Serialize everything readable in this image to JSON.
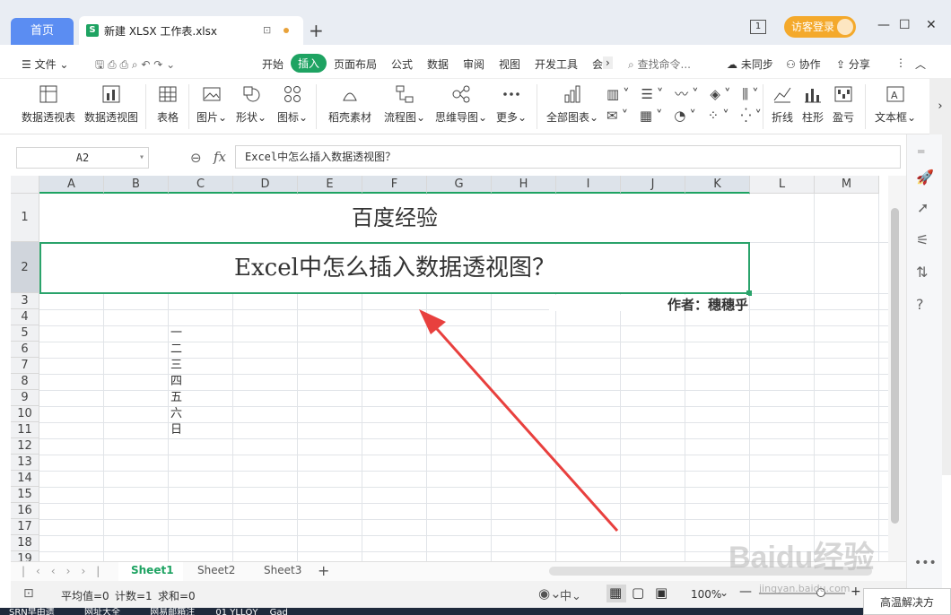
{
  "tabs": {
    "home": "首页",
    "file_badge": "S",
    "file_name": "新建 XLSX 工作表.xlsx",
    "new_tab": "+"
  },
  "window": {
    "page_num": "1",
    "login": "访客登录",
    "minimize": "—",
    "maximize": "☐",
    "close": "✕"
  },
  "menu": {
    "file": "文件",
    "items": [
      "开始",
      "插入",
      "页面布局",
      "公式",
      "数据",
      "审阅",
      "视图",
      "开发工具",
      "会"
    ],
    "active": "插入",
    "search": "查找命令...",
    "sync": "未同步",
    "collab": "协作",
    "share": "分享"
  },
  "ribbon": [
    {
      "label": "数据透视表",
      "icon": "pivot-table-icon"
    },
    {
      "label": "数据透视图",
      "icon": "pivot-chart-icon"
    },
    {
      "label": "表格",
      "icon": "table-icon"
    },
    {
      "label": "图片",
      "icon": "picture-icon"
    },
    {
      "label": "形状",
      "icon": "shape-icon"
    },
    {
      "label": "图标",
      "icon": "icons-icon"
    },
    {
      "label": "稻壳素材",
      "icon": "material-icon"
    },
    {
      "label": "流程图",
      "icon": "flowchart-icon"
    },
    {
      "label": "思维导图",
      "icon": "mindmap-icon"
    },
    {
      "label": "更多",
      "icon": "more-icon"
    },
    {
      "label": "全部图表",
      "icon": "all-charts-icon"
    },
    {
      "label": "折线",
      "icon": "line-chart-icon"
    },
    {
      "label": "柱形",
      "icon": "column-chart-icon"
    },
    {
      "label": "盈亏",
      "icon": "winloss-chart-icon"
    },
    {
      "label": "文本框",
      "icon": "textbox-icon"
    }
  ],
  "formula": {
    "cell_ref": "A2",
    "fx": "fx",
    "content": "Excel中怎么插入数据透视图？"
  },
  "columns": [
    "A",
    "B",
    "C",
    "D",
    "E",
    "F",
    "G",
    "H",
    "I",
    "J",
    "K",
    "L",
    "M"
  ],
  "rows": [
    "1",
    "2",
    "3",
    "4",
    "5",
    "6",
    "7",
    "8",
    "9",
    "10",
    "11",
    "12",
    "13",
    "14",
    "15",
    "16",
    "17",
    "18",
    "19"
  ],
  "cells": {
    "title": "百度经验",
    "subtitle": "Excel中怎么插入数据透视图？",
    "author": "作者：穗穗乎",
    "weekdays": [
      "一",
      "二",
      "三",
      "四",
      "五",
      "六",
      "日"
    ]
  },
  "sheets": {
    "tabs": [
      "Sheet1",
      "Sheet2",
      "Sheet3"
    ],
    "active": "Sheet1",
    "add": "+"
  },
  "status": {
    "avg": "平均值=0",
    "count": "计数=1",
    "sum": "求和=0",
    "zoom": "100%"
  },
  "watermark": "Baidu经验",
  "watermark_url": "jingyan.baidu.com",
  "notification": "高温解决方",
  "taskbar": [
    "SRN早由遗",
    "网址大全",
    "网易邮箱注",
    "01 YLLQY",
    "Gad"
  ],
  "colors": {
    "accent": "#1ea362",
    "home_tab": "#5b8df2",
    "login": "#f4a92b",
    "arrow": "#e8403e"
  }
}
